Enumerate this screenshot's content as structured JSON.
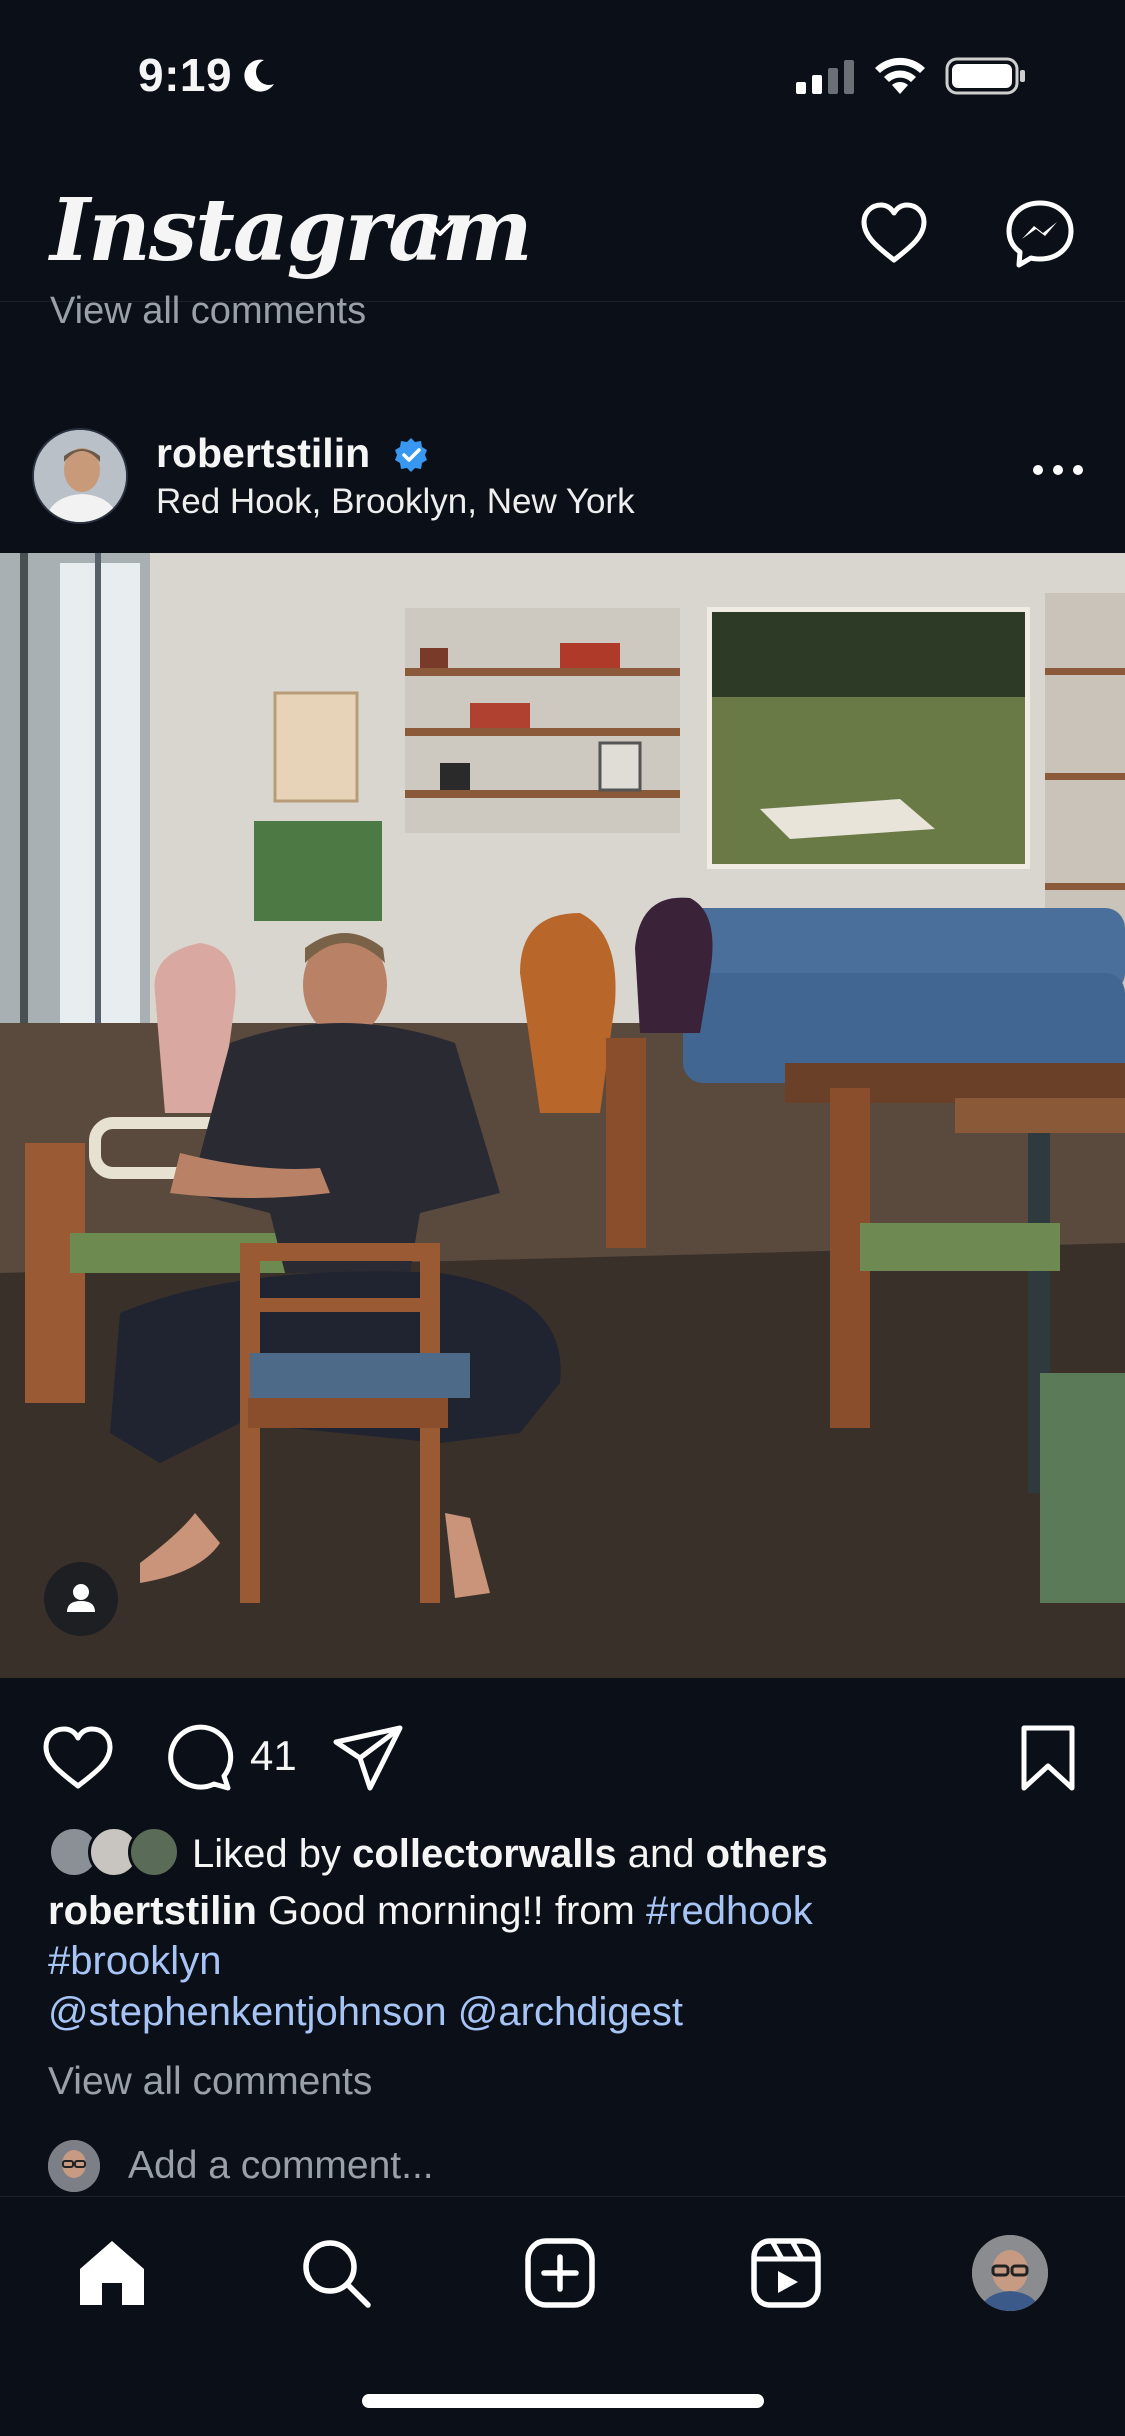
{
  "status_bar": {
    "time": "9:19"
  },
  "header": {
    "brand": "Instagram",
    "previous_post_comments_label": "View all comments"
  },
  "post": {
    "username": "robertstilin",
    "location": "Red Hook, Brooklyn, New York",
    "comment_count": "41",
    "likes": {
      "prefix": "Liked by",
      "first_liker": "collectorwalls",
      "joiner": "and",
      "rest": "others"
    },
    "caption": {
      "username": "robertstilin",
      "text": "Good morning!! from",
      "tag1": "#redhook",
      "tag2": "#brooklyn"
    },
    "mentions": "@stephenkentjohnson @archdigest",
    "view_all_comments": "View all comments",
    "add_comment_placeholder": "Add a comment..."
  },
  "icons": {
    "header": [
      "chevron-down-icon",
      "heart-icon",
      "messenger-icon"
    ],
    "actions": [
      "heart-icon",
      "comment-icon",
      "share-icon",
      "bookmark-icon"
    ],
    "nav": [
      "home-icon",
      "search-icon",
      "create-icon",
      "reels-icon",
      "profile-avatar"
    ]
  },
  "colors": {
    "background": "#0b0f17",
    "link": "#a6c4f5",
    "verified": "#3897f0",
    "muted": "#9aa0a8"
  }
}
